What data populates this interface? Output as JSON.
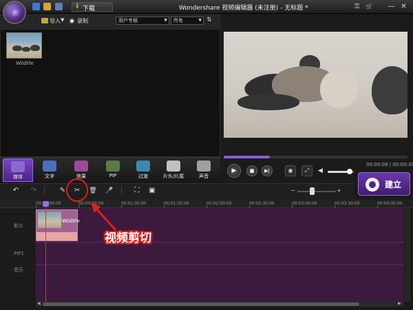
{
  "titlebar": {
    "download_label": "下载",
    "window_title": "Wondershare 视频编辑器 (未注册) - 无标题 *",
    "icons": [
      "app-logo-icon",
      "blue-square-icon",
      "folder-icon",
      "save-icon",
      "download-arrow-icon",
      "key-icon",
      "cart-icon",
      "minimize-icon",
      "close-icon"
    ],
    "minimize_glyph": "—",
    "close_glyph": "✕",
    "key_glyph": "⚿",
    "cart_glyph": "🛒"
  },
  "library_toolbar": {
    "import_label": "导入",
    "import_dropdown": "▼",
    "record_label": "录制",
    "album_select": "用户专辑",
    "filter_select": "所有",
    "sort_glyph": "⇅"
  },
  "library": {
    "items": [
      {
        "label": "Wildlife"
      }
    ]
  },
  "preview": {
    "progress_fraction": 0.25,
    "time_display": "00:00:08 / 00:00:30",
    "volume_fraction": 0.85
  },
  "tabs": [
    {
      "label": "媒体",
      "icon": "media-icon",
      "active": true,
      "color": "#8a6ad0"
    },
    {
      "label": "文字",
      "icon": "text-icon",
      "active": false,
      "color": "#4a6fc0"
    },
    {
      "label": "效果",
      "icon": "effects-icon",
      "active": false,
      "color": "#9a4a9a"
    },
    {
      "label": "PIP",
      "icon": "pip-icon",
      "active": false,
      "color": "#5a7a4a"
    },
    {
      "label": "过渡",
      "icon": "transition-icon",
      "active": false,
      "color": "#3a8ab0"
    },
    {
      "label": "片头/片尾",
      "icon": "intro-credits-icon",
      "active": false,
      "color": "#c0c0c0"
    },
    {
      "label": "声音",
      "icon": "sound-icon",
      "active": false,
      "color": "#a0a0a0"
    }
  ],
  "export": {
    "label": "建立"
  },
  "timeline": {
    "toolbar_glyphs": {
      "undo": "↶",
      "redo": "↷",
      "edit": "✎",
      "split": "✂",
      "delete": "🗑",
      "record": "🎤",
      "crop": "⛶",
      "snapshot": "▣",
      "zoom_minus": "−",
      "zoom_plus": "+"
    },
    "ruler": [
      "00:00:00:00",
      "00:00:30:00",
      "00:01:00:00",
      "00:01:30:00",
      "00:02:00:00",
      "00:02:30:00",
      "00:03:00:00",
      "00:03:30:00",
      "00:04:00:00"
    ],
    "tracks": [
      "影片",
      "PIP1",
      "音乐"
    ],
    "clip_label": "Wildlife"
  },
  "annotation": {
    "text": "视频剪切"
  }
}
